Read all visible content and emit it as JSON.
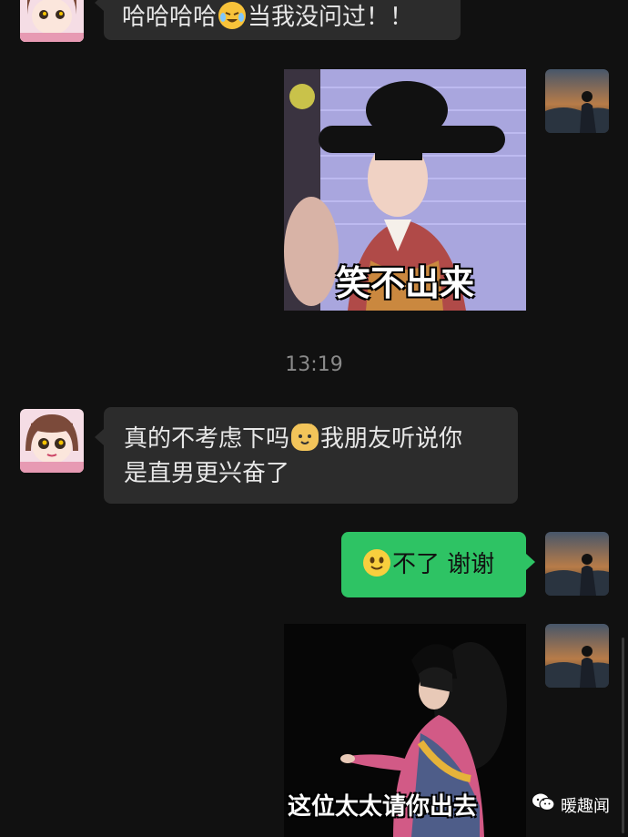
{
  "messages": [
    {
      "side": "left",
      "text_before": "哈哈哈哈",
      "emoji": "crying-laughing-emoji",
      "text_after": "当我没问过！！"
    },
    {
      "side": "right",
      "type": "sticker",
      "caption": "笑不出来"
    },
    {
      "side": "left",
      "line1_before": "真的不考虑下吗",
      "emoji": "cat-face-emoji",
      "line1_after": "我朋友听说你",
      "line2": "是直男更兴奋了"
    },
    {
      "side": "right",
      "emoji": "smile-emoji",
      "text": "不了 谢谢"
    },
    {
      "side": "right",
      "type": "sticker",
      "caption": "这位太太请你出去"
    }
  ],
  "timestamp": "13:19",
  "watermark": {
    "icon": "wechat-official-account-icon",
    "text": "暖趣闻"
  },
  "colors": {
    "background": "#111111",
    "left_bubble": "#2c2c2c",
    "right_bubble": "#2ec364"
  }
}
